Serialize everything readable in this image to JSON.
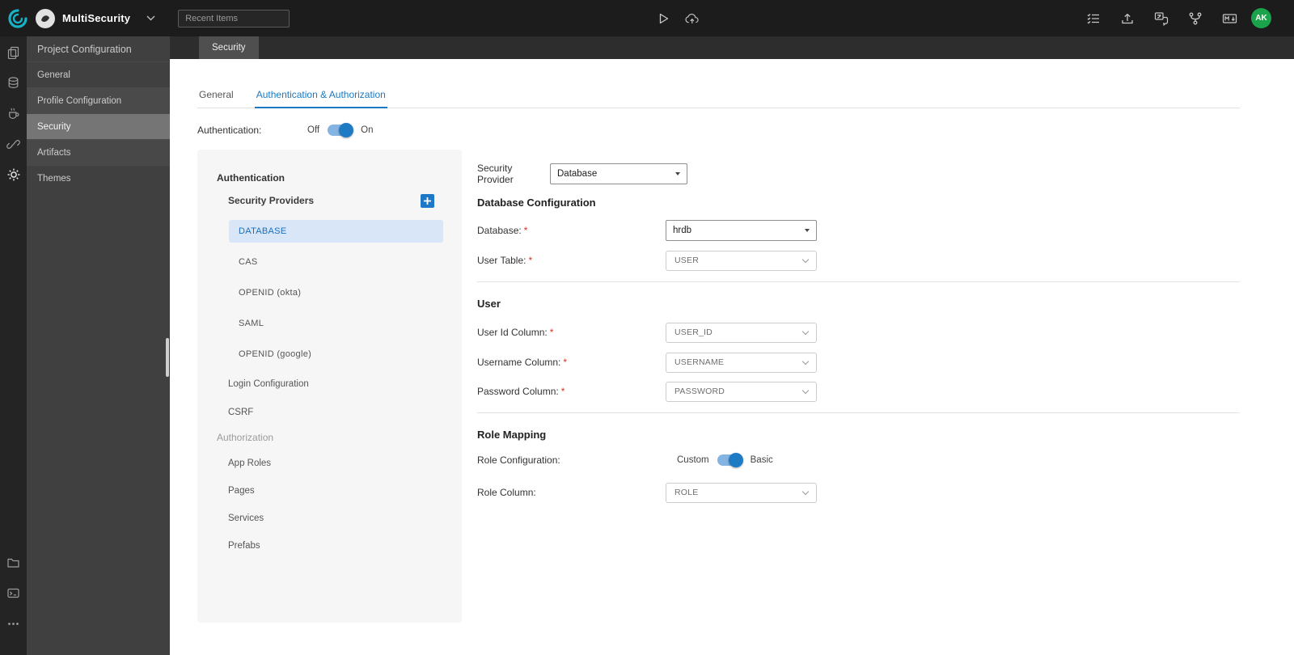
{
  "topbar": {
    "project_name": "MultiSecurity",
    "recent_items_placeholder": "Recent Items",
    "avatar_initials": "AK",
    "right_icons": [
      "task-list-icon",
      "export-icon",
      "translate-icon",
      "fork-icon",
      "markdown-icon"
    ],
    "center_icons": [
      "play-icon",
      "cloud-deploy-icon"
    ]
  },
  "rail_icons": [
    "pages-icon",
    "database-icon",
    "java-services-icon",
    "apis-icon",
    "settings-gear-icon",
    "folder-icon",
    "terminal-icon",
    "more-icon"
  ],
  "sidebar": {
    "title": "Project Configuration",
    "items": [
      {
        "label": "General"
      },
      {
        "label": "Profile Configuration"
      },
      {
        "label": "Security"
      },
      {
        "label": "Artifacts"
      },
      {
        "label": "Themes"
      }
    ],
    "active_item": "Security"
  },
  "tabstrip": {
    "active_tab": "Security"
  },
  "content": {
    "tabs": [
      {
        "label": "General"
      },
      {
        "label": "Authentication & Authorization"
      }
    ],
    "active_tab": "Authentication & Authorization",
    "authentication": {
      "label": "Authentication:",
      "off": "Off",
      "on": "On",
      "state": "On"
    },
    "tree": {
      "authentication_header": "Authentication",
      "security_providers_label": "Security Providers",
      "providers": [
        "DATABASE",
        "CAS",
        "OPENID (okta)",
        "SAML",
        "OPENID (google)"
      ],
      "selected_provider": "DATABASE",
      "login_configuration": "Login Configuration",
      "csrf": "CSRF",
      "authorization_header": "Authorization",
      "authorization_items": [
        "App Roles",
        "Pages",
        "Services",
        "Prefabs"
      ]
    },
    "form": {
      "required_marker": "*",
      "security_provider": {
        "label": "Security Provider",
        "value": "Database"
      },
      "database_section": {
        "title": "Database Configuration",
        "database": {
          "label": "Database:",
          "value": "hrdb",
          "required": true
        },
        "user_table": {
          "label": "User Table:",
          "value": "USER",
          "required": true
        }
      },
      "user_section": {
        "title": "User",
        "user_id": {
          "label": "User Id Column:",
          "value": "USER_ID",
          "required": true
        },
        "username": {
          "label": "Username Column:",
          "value": "USERNAME",
          "required": true
        },
        "password": {
          "label": "Password Column:",
          "value": "PASSWORD",
          "required": true
        }
      },
      "role_section": {
        "title": "Role Mapping",
        "role_configuration": {
          "label": "Role Configuration:",
          "left": "Custom",
          "right": "Basic",
          "state": "Basic"
        },
        "role_column": {
          "label": "Role Column:",
          "value": "ROLE",
          "required": false
        }
      }
    }
  },
  "colors": {
    "accent_blue": "#1f7ac4",
    "selected_item_bg": "#d8e6f7",
    "avatar_green": "#1aa34a",
    "topbar_bg": "#1c1c1c",
    "sidebar_bg": "#404040"
  }
}
